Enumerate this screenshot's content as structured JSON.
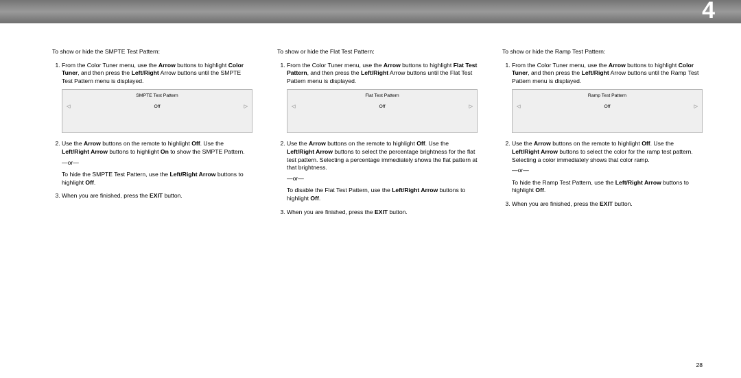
{
  "header": {
    "section_number": "4"
  },
  "footer": {
    "page_number": "28"
  },
  "columns": [
    {
      "intro": "To show or hide the SMPTE Test Pattern:",
      "step1_pre": "From the Color Tuner menu, use the ",
      "step1_b1": "Arrow",
      "step1_mid1": " buttons to highlight ",
      "step1_b2": "Color Tuner",
      "step1_mid2": ", and then press the ",
      "step1_b3": "Left/Right",
      "step1_post": " Arrow buttons until the SMPTE Test Pattern menu is displayed.",
      "ui_title": "SMPTE Test Pattern",
      "ui_value": "Off",
      "step2_pre": "Use the ",
      "step2_b1": "Arrow",
      "step2_mid1": " buttons on the remote to highlight ",
      "step2_b2": "Off",
      "step2_mid2": ". Use the ",
      "step2_b3": "Left/Right Arrow",
      "step2_mid3": " buttons to highlight ",
      "step2_b4": "On",
      "step2_post": " to show the SMPTE Pattern.",
      "or": "—or—",
      "alt_pre": "To hide the SMPTE Test Pattern, use the ",
      "alt_b1": "Left/Right Arrow",
      "alt_mid": " buttons to highlight ",
      "alt_b2": "Off",
      "alt_post": ".",
      "step3_pre": "When you are finished, press the ",
      "step3_b1": "EXIT",
      "step3_post": " button."
    },
    {
      "intro": "To show or hide the Flat Test Pattern:",
      "step1_pre": "From the Color Tuner menu, use the ",
      "step1_b1": "Arrow",
      "step1_mid1": " buttons to highlight ",
      "step1_b2": "Flat Test Pattern",
      "step1_mid2": ", and then press the ",
      "step1_b3": "Left/Right",
      "step1_post": " Arrow buttons until the Flat Test Pattern menu is displayed.",
      "ui_title": "Flat Test Pattern",
      "ui_value": "Off",
      "step2_pre": "Use the ",
      "step2_b1": "Arrow",
      "step2_mid1": " buttons on the remote to highlight ",
      "step2_b2": "Off",
      "step2_mid2": ". Use the ",
      "step2_b3": "Left/Right Arrow",
      "step2_post": " buttons to select the percentage brightness for the flat test pattern. Selecting a percentage immediately shows the flat pattern at that brightness.",
      "or": "—or—",
      "alt_pre": "To disable the Flat Test Pattern, use the ",
      "alt_b1": "Left/Right Arrow",
      "alt_mid": " buttons to highlight ",
      "alt_b2": "Off",
      "alt_post": ".",
      "step3_pre": "When you are finished, press the ",
      "step3_b1": "EXIT",
      "step3_post": " button."
    },
    {
      "intro": "To show or hide the Ramp Test Pattern:",
      "step1_pre": "From the Color Tuner menu, use the ",
      "step1_b1": "Arrow",
      "step1_mid1": " buttons to highlight ",
      "step1_b2": "Color Tuner",
      "step1_mid2": ", and then press the ",
      "step1_b3": "Left/Right",
      "step1_post": " Arrow buttons until the Ramp Test Pattern menu is displayed.",
      "ui_title": "Ramp Test Pattern",
      "ui_value": "Off",
      "step2_pre": "Use the ",
      "step2_b1": "Arrow",
      "step2_mid1": " buttons on the remote to highlight ",
      "step2_b2": "Off",
      "step2_mid2": ". Use the ",
      "step2_b3": "Left/Right Arrow",
      "step2_post": " buttons to select the color for the ramp test pattern. Selecting a color immediately shows that color ramp.",
      "or": "—or—",
      "alt_pre": "To hide the Ramp Test Pattern, use the ",
      "alt_b1": "Left/Right Arrow",
      "alt_mid": " buttons to highlight ",
      "alt_b2": "Off",
      "alt_post": ".",
      "step3_pre": "When you are finished, press the ",
      "step3_b1": "EXIT",
      "step3_post": " button."
    }
  ]
}
